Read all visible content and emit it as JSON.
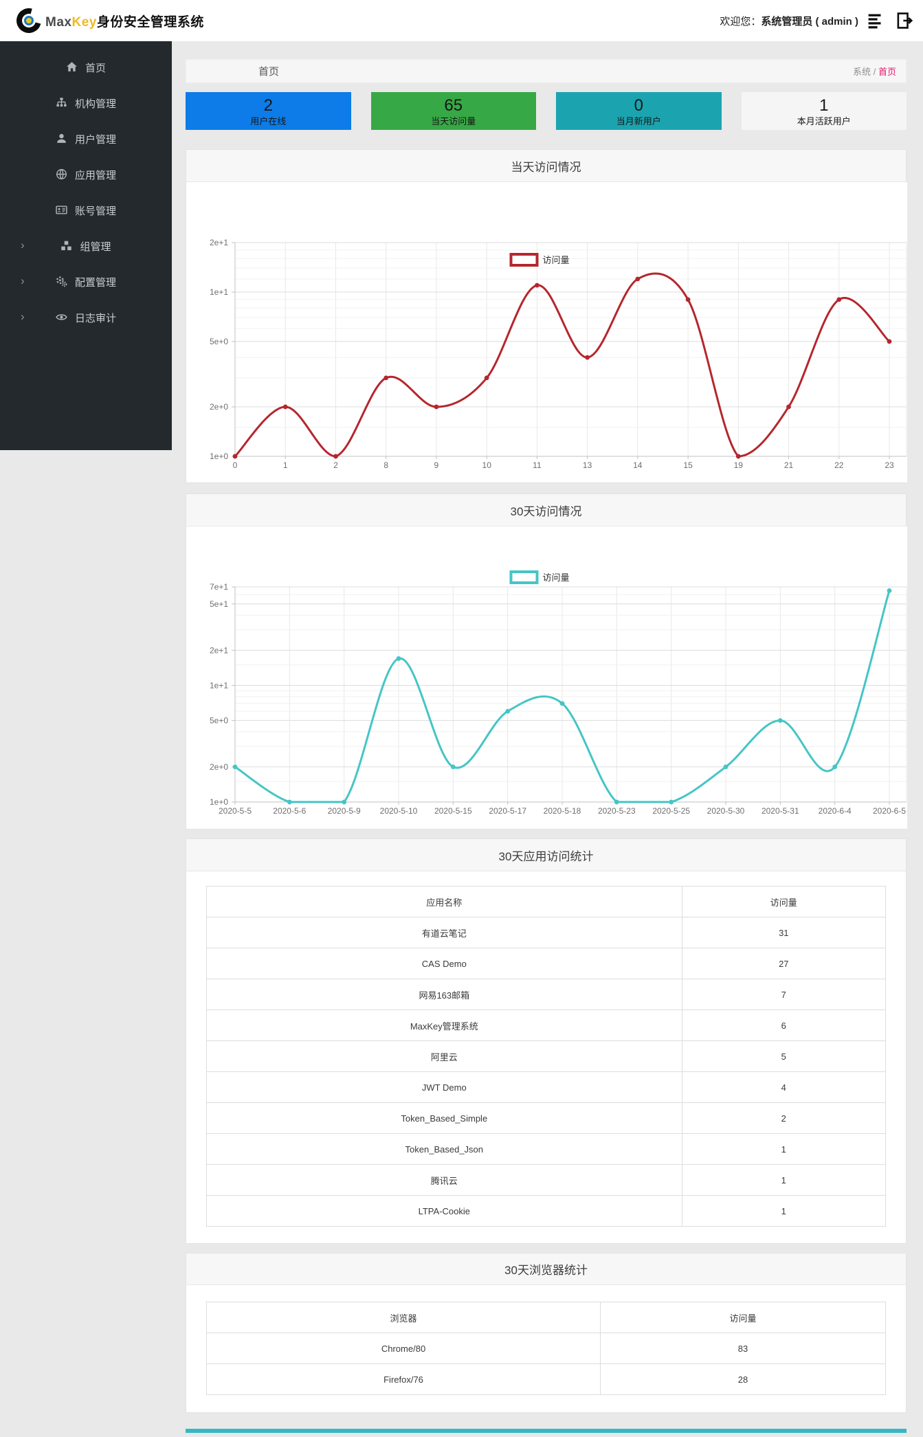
{
  "header": {
    "brand_max": "Max",
    "brand_key": "Key",
    "brand_suffix": "身份安全管理系统",
    "welcome_label": "欢迎您：",
    "username": "系统管理员 ( admin )",
    "icons": [
      "list-icon",
      "logout-icon"
    ]
  },
  "sidebar": {
    "items": [
      {
        "name": "sidebar-item-home",
        "label": "首页",
        "icon": "home-icon",
        "expandable": false
      },
      {
        "name": "sidebar-item-org",
        "label": "机构管理",
        "icon": "sitemap-icon",
        "expandable": false
      },
      {
        "name": "sidebar-item-users",
        "label": "用户管理",
        "icon": "user-icon",
        "expandable": false
      },
      {
        "name": "sidebar-item-apps",
        "label": "应用管理",
        "icon": "globe-icon",
        "expandable": false
      },
      {
        "name": "sidebar-item-accounts",
        "label": "账号管理",
        "icon": "id-card-icon",
        "expandable": false
      },
      {
        "name": "sidebar-item-groups",
        "label": "组管理",
        "icon": "cubes-icon",
        "expandable": true
      },
      {
        "name": "sidebar-item-config",
        "label": "配置管理",
        "icon": "gears-icon",
        "expandable": true
      },
      {
        "name": "sidebar-item-audit",
        "label": "日志审计",
        "icon": "eye-icon",
        "expandable": true
      }
    ]
  },
  "page": {
    "title": "首页",
    "breadcrumb": {
      "root": "系统",
      "separator": " / ",
      "current": "首页"
    }
  },
  "stats": [
    {
      "name": "stat-card-users-online",
      "value": "2",
      "label": "用户在线",
      "bg": "#0d7ce8",
      "text": "#161616"
    },
    {
      "name": "stat-card-today-visits",
      "value": "65",
      "label": "当天访问量",
      "bg": "#36a845",
      "text": "#161616"
    },
    {
      "name": "stat-card-new-users-month",
      "value": "0",
      "label": "当月新用户",
      "bg": "#1ba4b0",
      "text": "#161616"
    },
    {
      "name": "stat-card-active-users",
      "value": "1",
      "label": "本月活跃用户",
      "bg": "#f5f5f5",
      "text": "#161616"
    }
  ],
  "chart_data": [
    {
      "type": "line",
      "title": "当天访问情况",
      "legend": "访问量",
      "series_color": "#b5262e",
      "smooth": true,
      "x_categories": [
        "0",
        "1",
        "2",
        "8",
        "9",
        "10",
        "11",
        "13",
        "14",
        "15",
        "19",
        "21",
        "22",
        "23"
      ],
      "values": [
        1,
        2,
        1,
        3,
        2,
        3,
        11,
        4,
        12,
        9,
        1,
        2,
        9,
        5
      ],
      "xlabel": "",
      "ylabel": "",
      "y_scale": "log",
      "ylim": [
        1,
        20
      ],
      "y_ticks": [
        {
          "v": 20,
          "label": "2e+1"
        },
        {
          "v": 10,
          "label": "1e+1"
        },
        {
          "v": 5,
          "label": "5e+0"
        },
        {
          "v": 2,
          "label": "2e+0"
        },
        {
          "v": 1,
          "label": "1e+0"
        }
      ],
      "y_minor": [
        1.5,
        3,
        4,
        6,
        7,
        8,
        9,
        12,
        14,
        16,
        18
      ],
      "grid": true,
      "legend_position": "top-center"
    },
    {
      "type": "line",
      "title": "30天访问情况",
      "legend": "访问量",
      "series_color": "#45c5c5",
      "smooth": true,
      "x_categories": [
        "2020-5-5",
        "2020-5-6",
        "2020-5-9",
        "2020-5-10",
        "2020-5-15",
        "2020-5-17",
        "2020-5-18",
        "2020-5-23",
        "2020-5-25",
        "2020-5-30",
        "2020-5-31",
        "2020-6-4",
        "2020-6-5"
      ],
      "values": [
        2,
        1,
        1,
        17,
        2,
        6,
        7,
        1,
        1,
        2,
        5,
        2,
        65
      ],
      "xlabel": "",
      "ylabel": "",
      "y_scale": "log",
      "ylim": [
        1,
        70
      ],
      "y_ticks": [
        {
          "v": 70,
          "label": "7e+1"
        },
        {
          "v": 50,
          "label": "5e+1"
        },
        {
          "v": 20,
          "label": "2e+1"
        },
        {
          "v": 10,
          "label": "1e+1"
        },
        {
          "v": 5,
          "label": "5e+0"
        },
        {
          "v": 2,
          "label": "2e+0"
        },
        {
          "v": 1,
          "label": "1e+0"
        }
      ],
      "y_minor": [
        1.5,
        3,
        4,
        6,
        7,
        8,
        9,
        15,
        30,
        40,
        60
      ],
      "grid": true,
      "legend_position": "top-center"
    },
    {
      "type": "table",
      "title": "30天应用访问统计",
      "headers": [
        "应用名称",
        "访问量"
      ],
      "rows": [
        [
          "有道云笔记",
          "31"
        ],
        [
          "CAS Demo",
          "27"
        ],
        [
          "网易163邮箱",
          "7"
        ],
        [
          "MaxKey管理系统",
          "6"
        ],
        [
          "阿里云",
          "5"
        ],
        [
          "JWT Demo",
          "4"
        ],
        [
          "Token_Based_Simple",
          "2"
        ],
        [
          "Token_Based_Json",
          "1"
        ],
        [
          "腾讯云",
          "1"
        ],
        [
          "LTPA-Cookie",
          "1"
        ]
      ]
    },
    {
      "type": "table",
      "title": "30天浏览器统计",
      "headers": [
        "浏览器",
        "访问量"
      ],
      "rows": [
        [
          "Chrome/80",
          "83"
        ],
        [
          "Firefox/76",
          "28"
        ]
      ]
    }
  ],
  "colors": {
    "accent_pink": "#e8146c",
    "chart1_line": "#b5262e",
    "chart2_line": "#45c5c5",
    "sidebar_bg": "#24292e",
    "footer_bar": "#38b7c3"
  }
}
